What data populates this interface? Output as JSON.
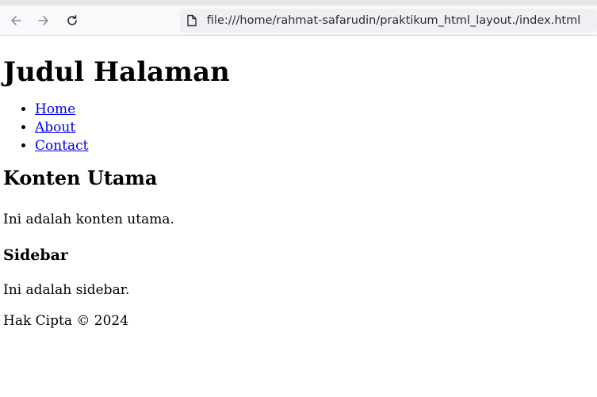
{
  "browser": {
    "url": "file:///home/rahmat-safarudin/praktikum_html_layout./index.html",
    "icons": [
      "back-arrow-icon",
      "forward-arrow-icon",
      "reload-icon",
      "file-icon"
    ]
  },
  "page": {
    "title": "Judul Halaman",
    "nav": [
      {
        "label": "Home"
      },
      {
        "label": "About"
      },
      {
        "label": "Contact"
      }
    ],
    "main_heading": "Konten Utama",
    "main_text": "Ini adalah konten utama.",
    "sidebar_heading": "Sidebar",
    "sidebar_text": "Ini adalah sidebar.",
    "footer": "Hak Cipta © 2024",
    "link_color": "#0000ee"
  }
}
